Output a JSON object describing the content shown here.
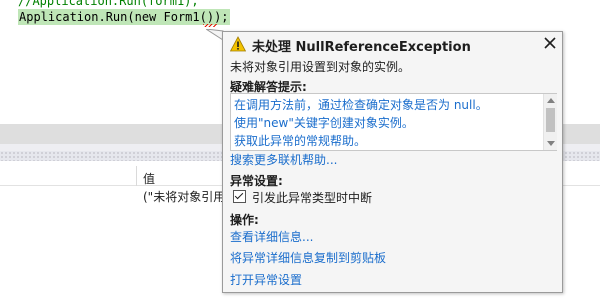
{
  "editor": {
    "comment_line": "//Application.Run(form1);",
    "current_line": "Application.Run(new Form1());"
  },
  "watch": {
    "value_header": "值",
    "row_value": "(\"未将对象引用"
  },
  "exception": {
    "title": "未处理 NullReferenceException",
    "message": "未将对象引用设置到对象的实例。",
    "tips_label": "疑难解答提示:",
    "tips": [
      "在调用方法前，通过检查确定对象是否为 null。",
      "使用\"new\"关键字创建对象实例。",
      "获取此异常的常规帮助。"
    ],
    "search_link": "搜索更多联机帮助...",
    "settings_label": "异常设置:",
    "break_checkbox_label": "引发此异常类型时中断",
    "break_checked": true,
    "actions_label": "操作:",
    "actions": [
      "查看详细信息...",
      "将异常详细信息复制到剪贴板",
      "打开异常设置"
    ]
  },
  "colors": {
    "link": "#1a6dcc",
    "current_line_highlight": "#bfe6b7",
    "warning": "#f2c200",
    "squiggle": "#e51400"
  },
  "icons": {
    "title": "warning-icon",
    "close": "close-icon",
    "checkbox": "checkmark-icon"
  }
}
